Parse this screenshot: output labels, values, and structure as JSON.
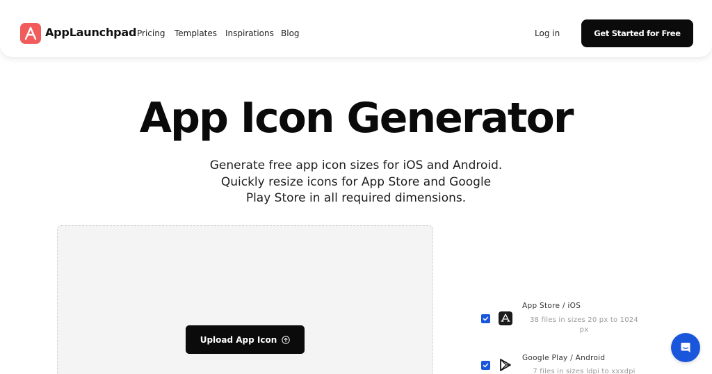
{
  "navbar": {
    "brand": "AppLaunchpad",
    "links": [
      "Pricing",
      "Templates",
      "Inspirations",
      "Blog"
    ],
    "login": "Log in",
    "cta": "Get Started for Free"
  },
  "hero": {
    "title": "App Icon Generator",
    "subtitle_lines": [
      "Generate free app icon sizes for iOS and Android.",
      "Quickly resize icons for App Store and Google",
      "Play Store in all required dimensions."
    ]
  },
  "upload": {
    "button_label": "Upload App Icon"
  },
  "platforms": [
    {
      "title": "App Store / iOS",
      "desc_lines": [
        "38 files in sizes 20 px to 1024",
        "px"
      ],
      "checked": true,
      "icon": "app-store-icon"
    },
    {
      "title": "Google Play / Android",
      "desc_lines": [
        "7 files in sizes ldpi to xxxdpi"
      ],
      "checked": true,
      "icon": "google-play-icon"
    }
  ],
  "colors": {
    "brand": "#f15b5b",
    "accent": "#1a56db",
    "dark": "#0b0b0b"
  }
}
